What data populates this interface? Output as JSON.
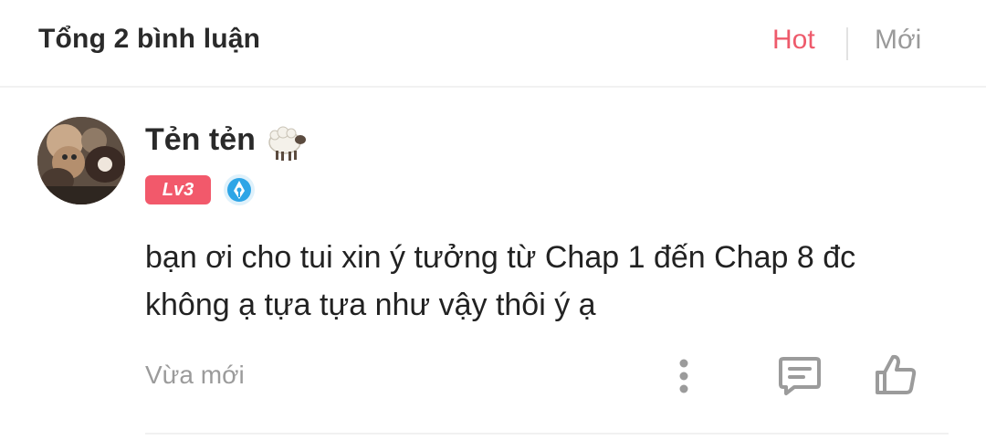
{
  "header": {
    "title": "Tổng 2 bình luận",
    "sort_hot": "Hot",
    "sort_new": "Mới",
    "active_color": "#ee5a6b"
  },
  "comment": {
    "username": "Tẻn tẻn",
    "emoji_icon": "sheep-icon",
    "level_badge": "Lv3",
    "badge_color": "#f2596b",
    "verify_icon": "verified-pen-icon",
    "text": "bạn ơi cho tui xin ý tưởng từ Chap 1 đến Chap 8 đc không ạ tựa tựa như vậy thôi ý ạ",
    "time": "Vừa mới",
    "actions": [
      "more-icon",
      "reply-icon",
      "like-icon"
    ]
  }
}
